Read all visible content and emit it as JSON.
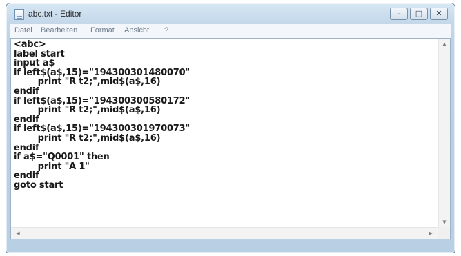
{
  "window": {
    "title": "abc.txt - Editor",
    "controls": {
      "minimize": "–",
      "maximize": "□",
      "close": "✕"
    }
  },
  "menu": [
    "Datei",
    "Bearbeiten",
    "Format",
    "Ansicht",
    "?"
  ],
  "editor": {
    "content": "<abc>\nlabel start\ninput a$\nif left$(a$,15)=\"194300301480070\"\n        print \"R t2;\",mid$(a$,16)\nendif\nif left$(a$,15)=\"194300300580172\"\n        print \"R t2;\",mid$(a$,16)\nendif\nif left$(a$,15)=\"194300301970073\"\n        print \"R t2;\",mid$(a$,16)\nendif\nif a$=\"Q0001\" then\n        print \"A 1\"\nendif\ngoto start"
  },
  "scrollbars": {
    "up": "▲",
    "down": "▼",
    "left": "◀",
    "right": "▶"
  },
  "icons": {
    "app": "notepad-icon"
  },
  "colors": {
    "frame": "#c4d8ea",
    "menu_bg": "#f3f6fa",
    "text": "#1a1a1a"
  }
}
